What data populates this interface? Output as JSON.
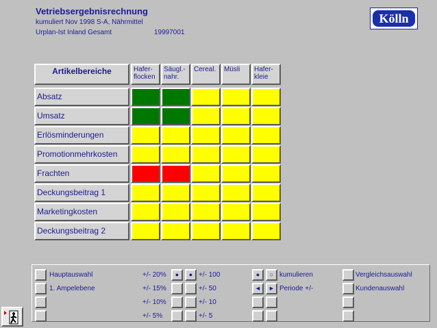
{
  "header": {
    "title": "Vetriebsergebnisrechnung",
    "line1": "kumuliert Nov 1998  S-A, Nährmittel",
    "line2": "Urplan-Ist  Inland Gesamt",
    "code": "19997001",
    "logo_text": "Kölln"
  },
  "matrix": {
    "corner_label": "Artikelbereiche",
    "columns": [
      {
        "line1": "Hafer-",
        "line2": "flocken"
      },
      {
        "line1": "Säugl.-",
        "line2": "nahr."
      },
      {
        "line1": "Cereal.",
        "line2": ""
      },
      {
        "line1": "Müsli",
        "line2": ""
      },
      {
        "line1": "Hafer-",
        "line2": "kleie"
      }
    ],
    "rows": [
      {
        "label": "Absatz",
        "status": [
          "green",
          "green",
          "yellow",
          "yellow",
          "yellow"
        ]
      },
      {
        "label": "Umsatz",
        "status": [
          "green",
          "green",
          "yellow",
          "yellow",
          "yellow"
        ]
      },
      {
        "label": "Erlösminderungen",
        "status": [
          "yellow",
          "yellow",
          "yellow",
          "yellow",
          "yellow"
        ]
      },
      {
        "label": "Promotionmehrkosten",
        "status": [
          "yellow",
          "yellow",
          "yellow",
          "yellow",
          "yellow"
        ]
      },
      {
        "label": "Frachten",
        "status": [
          "red",
          "red",
          "yellow",
          "yellow",
          "yellow"
        ]
      },
      {
        "label": "Deckungsbeitrag 1",
        "status": [
          "yellow",
          "yellow",
          "yellow",
          "yellow",
          "yellow"
        ]
      },
      {
        "label": "Marketingkosten",
        "status": [
          "yellow",
          "yellow",
          "yellow",
          "yellow",
          "yellow"
        ]
      },
      {
        "label": "Deckungsbeitrag 2",
        "status": [
          "yellow",
          "yellow",
          "yellow",
          "yellow",
          "yellow"
        ]
      }
    ],
    "colors": {
      "green": "#007800",
      "yellow": "#ffff00",
      "red": "#ff0000"
    }
  },
  "controls": {
    "main_select": "Hauptauswahl",
    "level": "1. Ampelebene",
    "pct": [
      "+/- 20%",
      "+/- 15%",
      "+/- 10%",
      "+/-   5%"
    ],
    "abs": [
      "+/- 100",
      "+/-   50",
      "+/-   10",
      "+/-     5"
    ],
    "cumulate": "kumulieren",
    "period": "Periode +/-",
    "compare": "Vergleichsauswahl",
    "customer": "Kundenauswahl",
    "selected_pct": "+/- 20%",
    "selected_abs": "+/- 100",
    "cumulate_on": true
  },
  "icons": {
    "radio_on": "●",
    "radio_off": "○",
    "arrow_left": "◄",
    "arrow_right": "►",
    "exit": "door-exit-icon"
  }
}
